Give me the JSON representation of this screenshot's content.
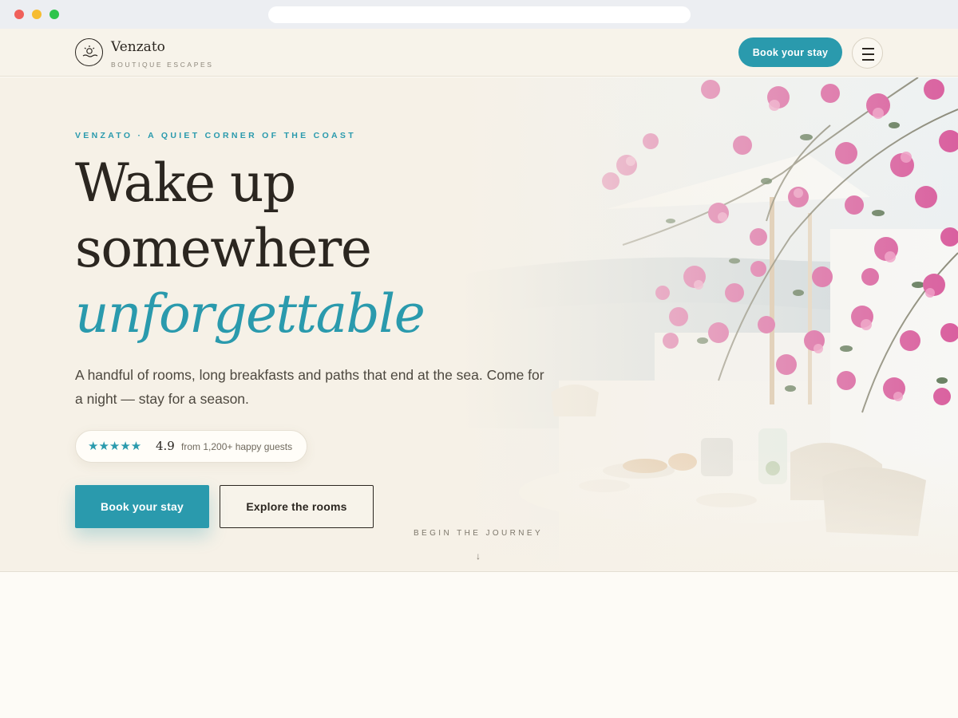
{
  "brand": {
    "name": "Venzato",
    "tagline": "BOUTIQUE ESCAPES"
  },
  "header": {
    "cta_label": "Book your stay",
    "menu_icon": "hamburger-menu-icon"
  },
  "hero": {
    "eyebrow": "VENZATO · A QUIET CORNER OF THE COAST",
    "headline_line1": "Wake up",
    "headline_line2": "somewhere",
    "headline_accent": "unforgettable",
    "lead": "A handful of rooms, long breakfasts and paths that end at the sea. Come for a night — stay for a season.",
    "rating": {
      "stars": "★★★★★",
      "score": "4.9",
      "caption": "from 1,200+ happy guests"
    },
    "primary_cta": "Book your stay",
    "secondary_cta": "Explore the rooms",
    "scroll_hint": "BEGIN THE JOURNEY",
    "scroll_arrow": "↓"
  },
  "colors": {
    "accent": "#2a9aad",
    "ink": "#2b2620",
    "cream": "#f7f3ea",
    "blossom": "#d9609f"
  }
}
